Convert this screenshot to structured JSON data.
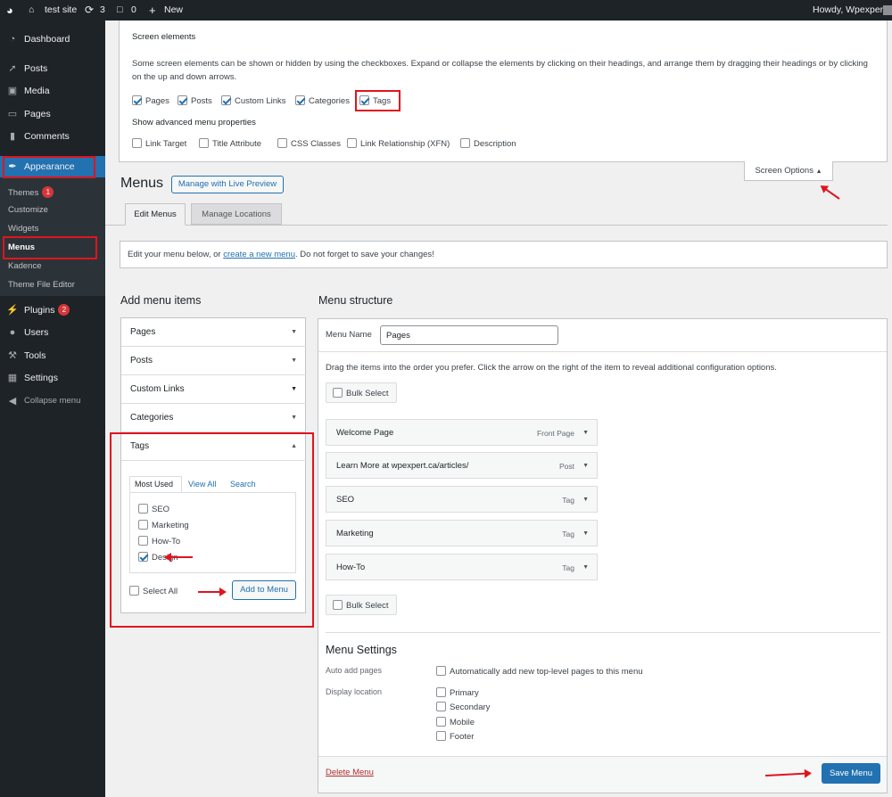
{
  "adminbar": {
    "site": "test site",
    "updates": "3",
    "comments": "0",
    "new": "New",
    "howdy": "Howdy, Wpexpert"
  },
  "sidebar": {
    "dashboard": "Dashboard",
    "posts": "Posts",
    "media": "Media",
    "pages": "Pages",
    "comments": "Comments",
    "appearance": "Appearance",
    "sub": {
      "themes": "Themes",
      "themes_badge": "1",
      "customize": "Customize",
      "widgets": "Widgets",
      "menus": "Menus",
      "kadence": "Kadence",
      "theme_editor": "Theme File Editor"
    },
    "plugins": "Plugins",
    "plugins_badge": "2",
    "users": "Users",
    "tools": "Tools",
    "settings": "Settings",
    "collapse": "Collapse menu"
  },
  "screen_options": {
    "heading": "Screen elements",
    "desc": "Some screen elements can be shown or hidden by using the checkboxes. Expand or collapse the elements by clicking on their headings, and arrange them by dragging their headings or by clicking on the up and down arrows.",
    "boxes": [
      {
        "label": "Pages",
        "checked": true
      },
      {
        "label": "Posts",
        "checked": true
      },
      {
        "label": "Custom Links",
        "checked": true
      },
      {
        "label": "Categories",
        "checked": true
      },
      {
        "label": "Tags",
        "checked": true
      }
    ],
    "adv_heading": "Show advanced menu properties",
    "adv": [
      {
        "label": "Link Target",
        "checked": false
      },
      {
        "label": "Title Attribute",
        "checked": false
      },
      {
        "label": "CSS Classes",
        "checked": false
      },
      {
        "label": "Link Relationship (XFN)",
        "checked": false
      },
      {
        "label": "Description",
        "checked": false
      }
    ],
    "toggle": "Screen Options"
  },
  "page": {
    "title": "Menus",
    "live_preview": "Manage with Live Preview",
    "tab_edit": "Edit Menus",
    "tab_locations": "Manage Locations",
    "notice_pre": "Edit your menu below, or ",
    "notice_link": "create a new menu",
    "notice_post": ". Do not forget to save your changes!"
  },
  "add_items": {
    "heading": "Add menu items",
    "sections": [
      "Pages",
      "Posts",
      "Custom Links",
      "Categories",
      "Tags"
    ],
    "tabs": [
      "Most Used",
      "View All",
      "Search"
    ],
    "tags": [
      {
        "label": "SEO",
        "checked": false
      },
      {
        "label": "Marketing",
        "checked": false
      },
      {
        "label": "How-To",
        "checked": false
      },
      {
        "label": "Design",
        "checked": true
      }
    ],
    "select_all": "Select All",
    "add_button": "Add to Menu"
  },
  "structure": {
    "heading": "Menu structure",
    "name_label": "Menu Name",
    "name_value": "Pages",
    "instructions": "Drag the items into the order you prefer. Click the arrow on the right of the item to reveal additional configuration options.",
    "bulk_select": "Bulk Select",
    "items": [
      {
        "title": "Welcome Page",
        "type": "Front Page"
      },
      {
        "title": "Learn More at wpexpert.ca/articles/",
        "type": "Post"
      },
      {
        "title": "SEO",
        "type": "Tag"
      },
      {
        "title": "Marketing",
        "type": "Tag"
      },
      {
        "title": "How-To",
        "type": "Tag"
      }
    ],
    "settings_heading": "Menu Settings",
    "auto_add_label": "Auto add pages",
    "auto_add_text": "Automatically add new top-level pages to this menu",
    "display_label": "Display location",
    "locations": [
      "Primary",
      "Secondary",
      "Mobile",
      "Footer"
    ],
    "delete": "Delete Menu",
    "save": "Save Menu"
  }
}
